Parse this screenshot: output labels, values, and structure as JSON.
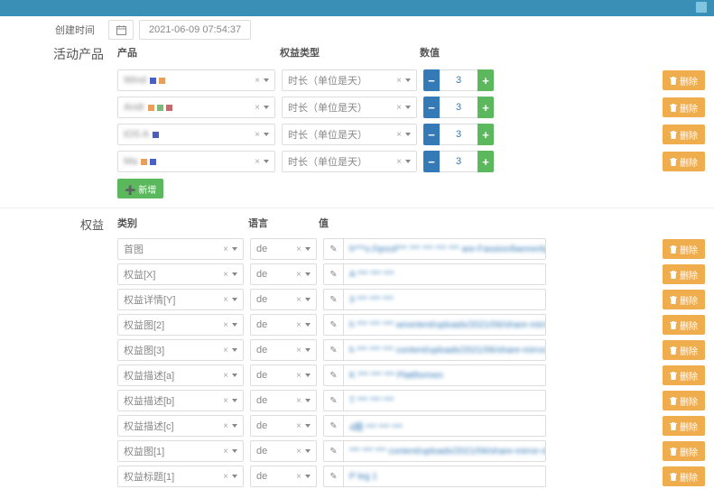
{
  "datetime_label": "创建时间",
  "datetime_value": "2021-06-09 07:54:37",
  "section_products": "活动产品",
  "section_rights": "权益",
  "headers": {
    "product": "产品",
    "type": "权益类型",
    "number": "数值",
    "category": "类别",
    "language": "语言",
    "value": "值"
  },
  "type_option": "时长（单位是天）",
  "btn_delete": "删除",
  "btn_add": "➕ 新增",
  "products": [
    {
      "name": "Wind",
      "num": "3"
    },
    {
      "name": "Andr",
      "num": "3"
    },
    {
      "name": "iOS A",
      "num": "3"
    },
    {
      "name": "Ma",
      "num": "3"
    }
  ],
  "rights": [
    {
      "cat": "首图",
      "lang": "de",
      "val": "h***s://qncd*** *** *** *** *** are-Fassion/bannerbg.jpg"
    },
    {
      "cat": "权益[X]",
      "lang": "de",
      "val": "A *** *** ***"
    },
    {
      "cat": "权益详情[Y]",
      "lang": "de",
      "val": "3 *** *** ***"
    },
    {
      "cat": "权益图[2]",
      "lang": "de",
      "val": "h *** *** *** wnontent/uploads/2021/06/share-mirror-d"
    },
    {
      "cat": "权益图[3]",
      "lang": "de",
      "val": "h *** *** *** content/uploads/2021/06/share-mirror-d"
    },
    {
      "cat": "权益描述[a]",
      "lang": "de",
      "val": "K *** *** *** Plattformen"
    },
    {
      "cat": "权益描述[b]",
      "lang": "de",
      "val": "T *** *** ***"
    },
    {
      "cat": "权益描述[c]",
      "lang": "de",
      "val": "4题 *** *** ***"
    },
    {
      "cat": "权益图[1]",
      "lang": "de",
      "val": "*** *** *** content/uploads/2021/06/share-mirror-d"
    },
    {
      "cat": "权益标题[1]",
      "lang": "de",
      "val": "P   leg 1"
    }
  ]
}
